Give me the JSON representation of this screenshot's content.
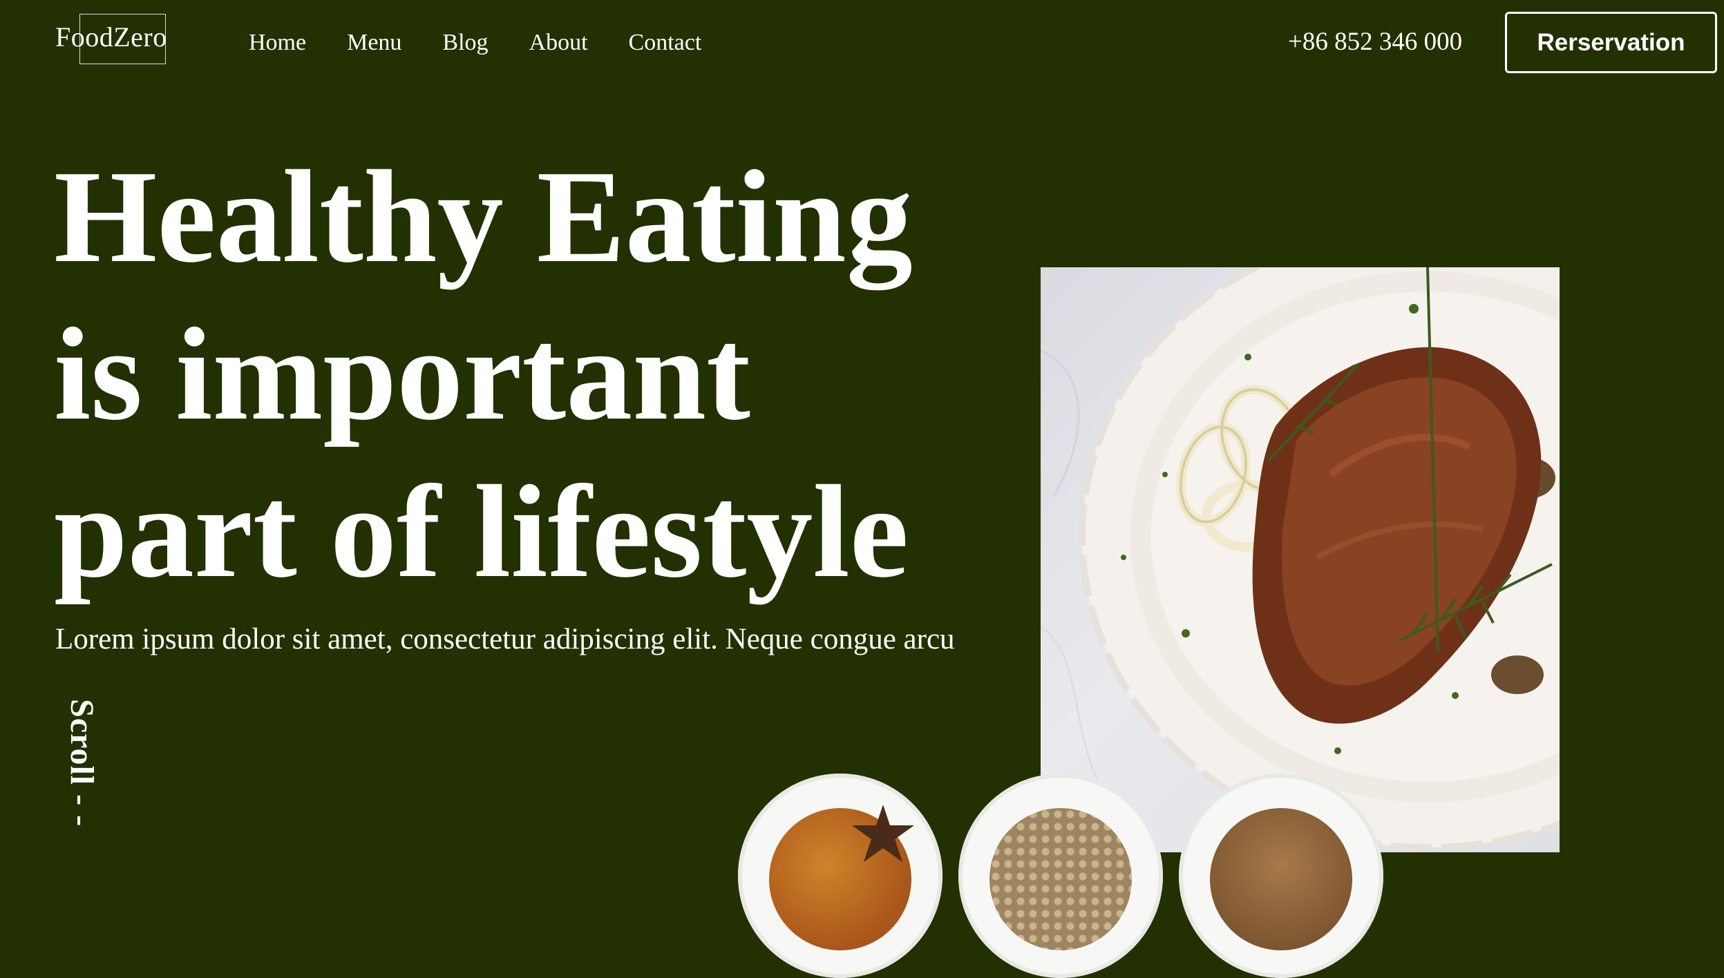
{
  "header": {
    "logo_text": "FoodZero",
    "nav": [
      "Home",
      "Menu",
      "Blog",
      "About",
      "Contact"
    ],
    "phone": "+86 852 346 000",
    "reservation_label": "Rerservation"
  },
  "hero": {
    "title_lines": [
      "Healthy Eating",
      "is important",
      "part of lifestyle"
    ],
    "subtitle": "Lorem ipsum dolor sit amet, consectetur adipiscing elit. Neque congue arcu",
    "scroll_label": "Scroll - -"
  },
  "colors": {
    "background": "#233001",
    "text": "#ffffff"
  },
  "images": {
    "main_dish": "steak-plate-photo",
    "spice_bowls": [
      "paprika-star-anise-bowl",
      "peppercorn-bowl",
      "ground-spice-bowl"
    ]
  }
}
